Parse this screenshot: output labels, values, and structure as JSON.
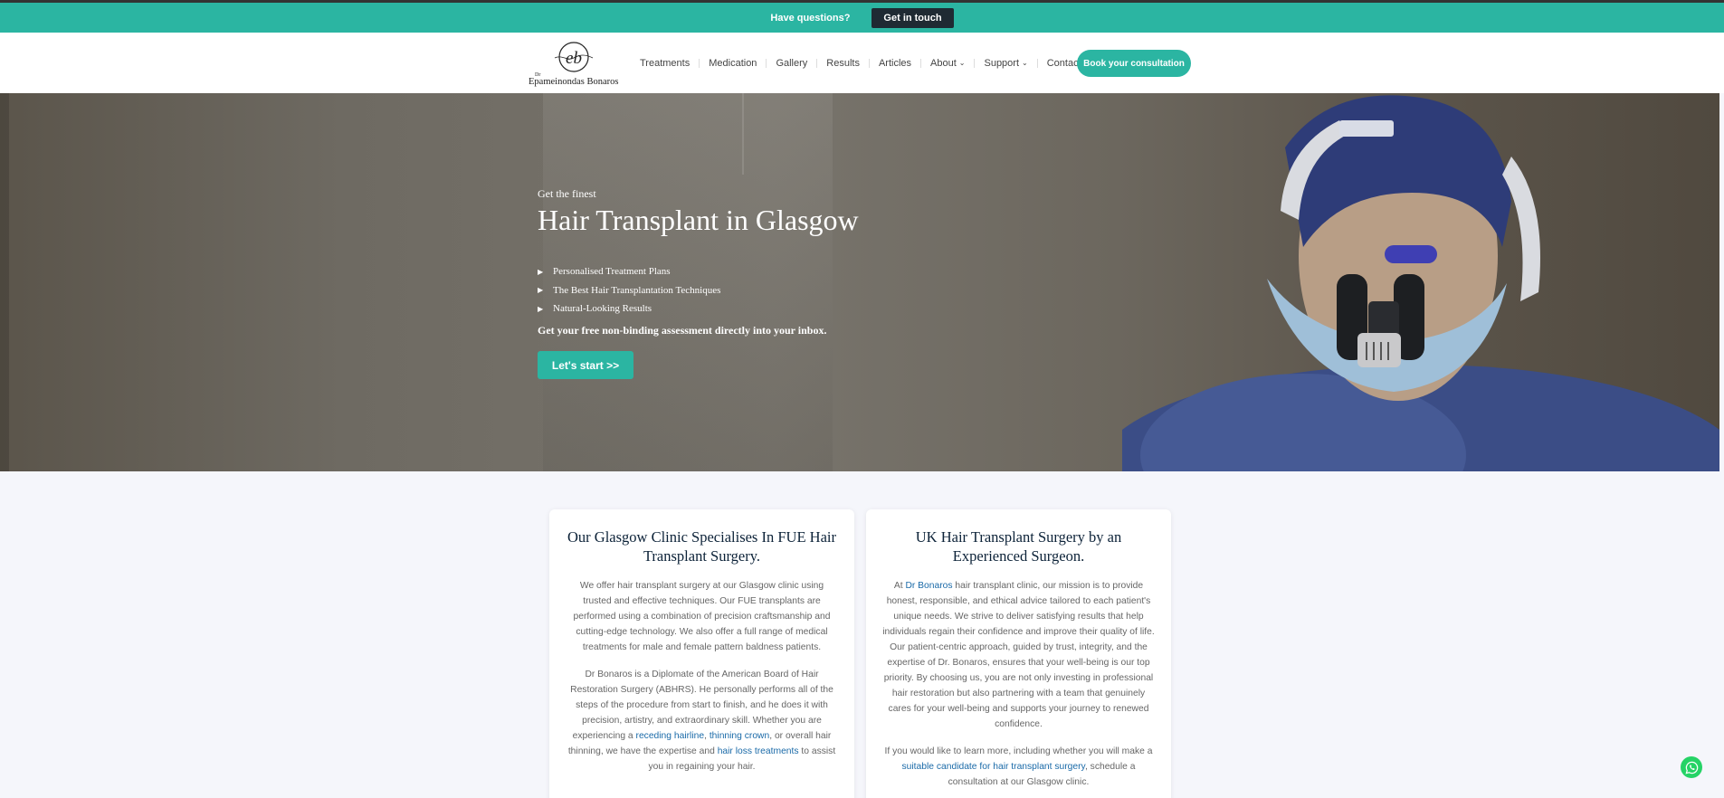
{
  "topbar": {
    "question": "Have questions?",
    "button": "Get in touch"
  },
  "logo": {
    "monogram": "eb",
    "prefix": "Dr",
    "name": "Epameinondas Bonaros"
  },
  "nav": {
    "items": [
      {
        "label": "Treatments",
        "dropdown": false
      },
      {
        "label": "Medication",
        "dropdown": false
      },
      {
        "label": "Gallery",
        "dropdown": false
      },
      {
        "label": "Results",
        "dropdown": false
      },
      {
        "label": "Articles",
        "dropdown": false
      },
      {
        "label": "About",
        "dropdown": true
      },
      {
        "label": "Support",
        "dropdown": true
      },
      {
        "label": "Contact",
        "dropdown": false
      }
    ],
    "cta": "Book your consultation"
  },
  "hero": {
    "pre": "Get the finest",
    "title": "Hair Transplant in Glasgow",
    "bullets": [
      "Personalised Treatment Plans",
      "The Best Hair Transplantation Techniques",
      "Natural-Looking Results"
    ],
    "assessment": "Get your free non-binding assessment directly into your inbox.",
    "button": "Let's start >>"
  },
  "card1": {
    "title": "Our Glasgow Clinic Specialises In FUE Hair Transplant Surgery.",
    "p1": "We offer hair transplant surgery at our Glasgow clinic using trusted and effective techniques. Our FUE transplants are performed using a combination of precision craftsmanship and cutting-edge technology. We also offer a full range of medical treatments for male and female pattern baldness patients.",
    "p2a": "Dr Bonaros is a Diplomate of the American Board of Hair Restoration Surgery (ABHRS). He personally performs all of the steps of the procedure from start to finish, and he does it with precision, artistry, and extraordinary skill. Whether you are experiencing a ",
    "link1": "receding hairline",
    "p2b": ", ",
    "link2": "thinning crown",
    "p2c": ", or overall hair thinning, we have the expertise and ",
    "link3": "hair loss treatments",
    "p2d": " to assist you in regaining your hair."
  },
  "card2": {
    "title": "UK Hair Transplant Surgery by an Experienced Surgeon.",
    "p1a": "At ",
    "link1": "Dr Bonaros",
    "p1b": " hair transplant clinic, our mission is to provide honest, responsible, and ethical advice tailored to each patient's unique needs. We strive to deliver satisfying results that help individuals regain their confidence and improve their quality of life. Our patient-centric approach, guided by trust, integrity, and the expertise of Dr. Bonaros, ensures that your well-being is our top priority. By choosing us, you are not only investing in professional hair restoration but also partnering with a team that genuinely cares for your well-being and supports your journey to renewed confidence.",
    "p2a": "If you would like to learn more, including whether you will make a ",
    "link2": "suitable candidate for hair transplant surgery",
    "p2b": ", schedule a consultation at our Glasgow clinic."
  },
  "colors": {
    "accent": "#2bb5a2",
    "dark": "#1f2a33",
    "heading": "#0c2238",
    "link": "#1a6aa8",
    "whatsapp": "#25d366"
  },
  "icons": {
    "whatsapp": "whatsapp-icon",
    "bullet": "caret-right-icon",
    "dropdown": "chevron-down-icon"
  }
}
